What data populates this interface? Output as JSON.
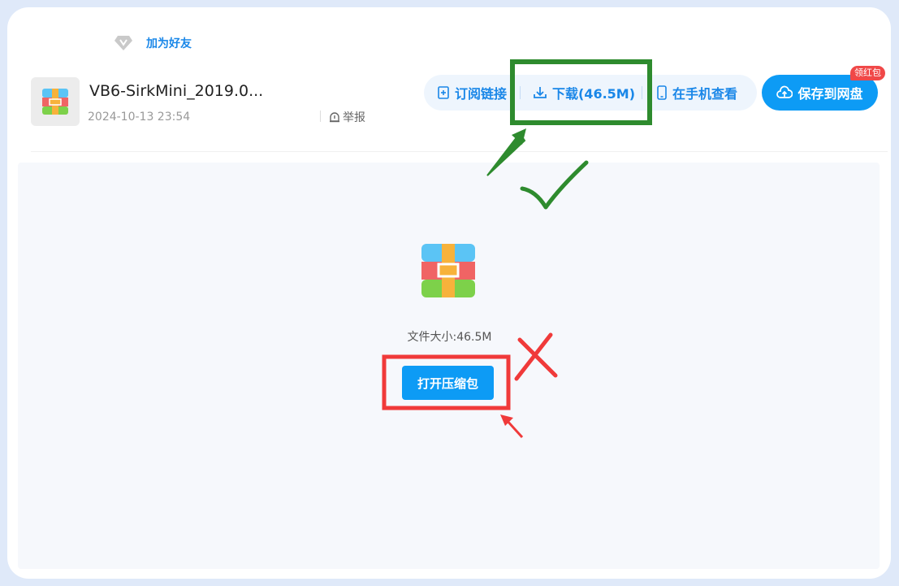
{
  "vip": {
    "icon": "diamond-icon",
    "label": "加为好友"
  },
  "file": {
    "name": "VB6-SirkMini_2019.0...",
    "date": "2024-10-13 23:54",
    "report_label": "举报",
    "icon": "archive-icon"
  },
  "actions": {
    "subscribe_label": "订阅链接",
    "download_label": "下载(46.5M)",
    "mobile_label": "在手机查看",
    "save_label": "保存到网盘",
    "badge_label": "领红包"
  },
  "preview": {
    "size_text": "文件大小:46.5M",
    "open_label": "打开压缩包"
  },
  "colors": {
    "accent": "#0d9bf5",
    "link": "#1a87e8",
    "annotation_green": "#2e8b2e",
    "annotation_red": "#f03a3a"
  }
}
